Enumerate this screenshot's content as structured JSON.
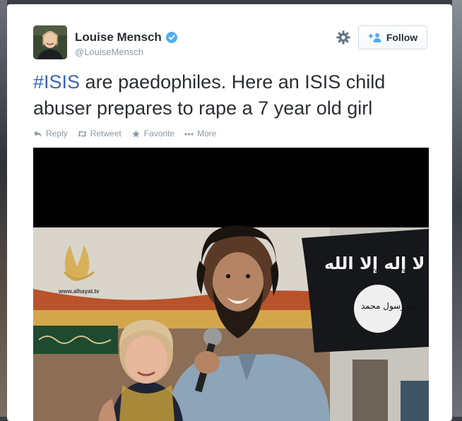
{
  "author": {
    "display_name": "Louise Mensch",
    "handle": "@LouiseMensch",
    "verified": true
  },
  "follow_button": {
    "label": "Follow"
  },
  "tweet": {
    "hashtag": "#ISIS",
    "text": " are paedophiles. Here an ISIS child abuser prepares to rape a 7 year old girl"
  },
  "actions": [
    {
      "label": "Reply",
      "icon": "reply-icon"
    },
    {
      "label": "Retweet",
      "icon": "retweet-icon"
    },
    {
      "label": "Favorite",
      "icon": "star-icon"
    },
    {
      "label": "More",
      "icon": "more-dots-icon"
    }
  ],
  "media": {
    "watermark": "www.alhayat.tv",
    "flag_text_top": "لا إله إلا الله",
    "flag_seal_text": "الله رسول محمد"
  },
  "colors": {
    "accent": "#3b66b8",
    "muted": "#8899a6",
    "text": "#292f33",
    "verified": "#55acee"
  }
}
